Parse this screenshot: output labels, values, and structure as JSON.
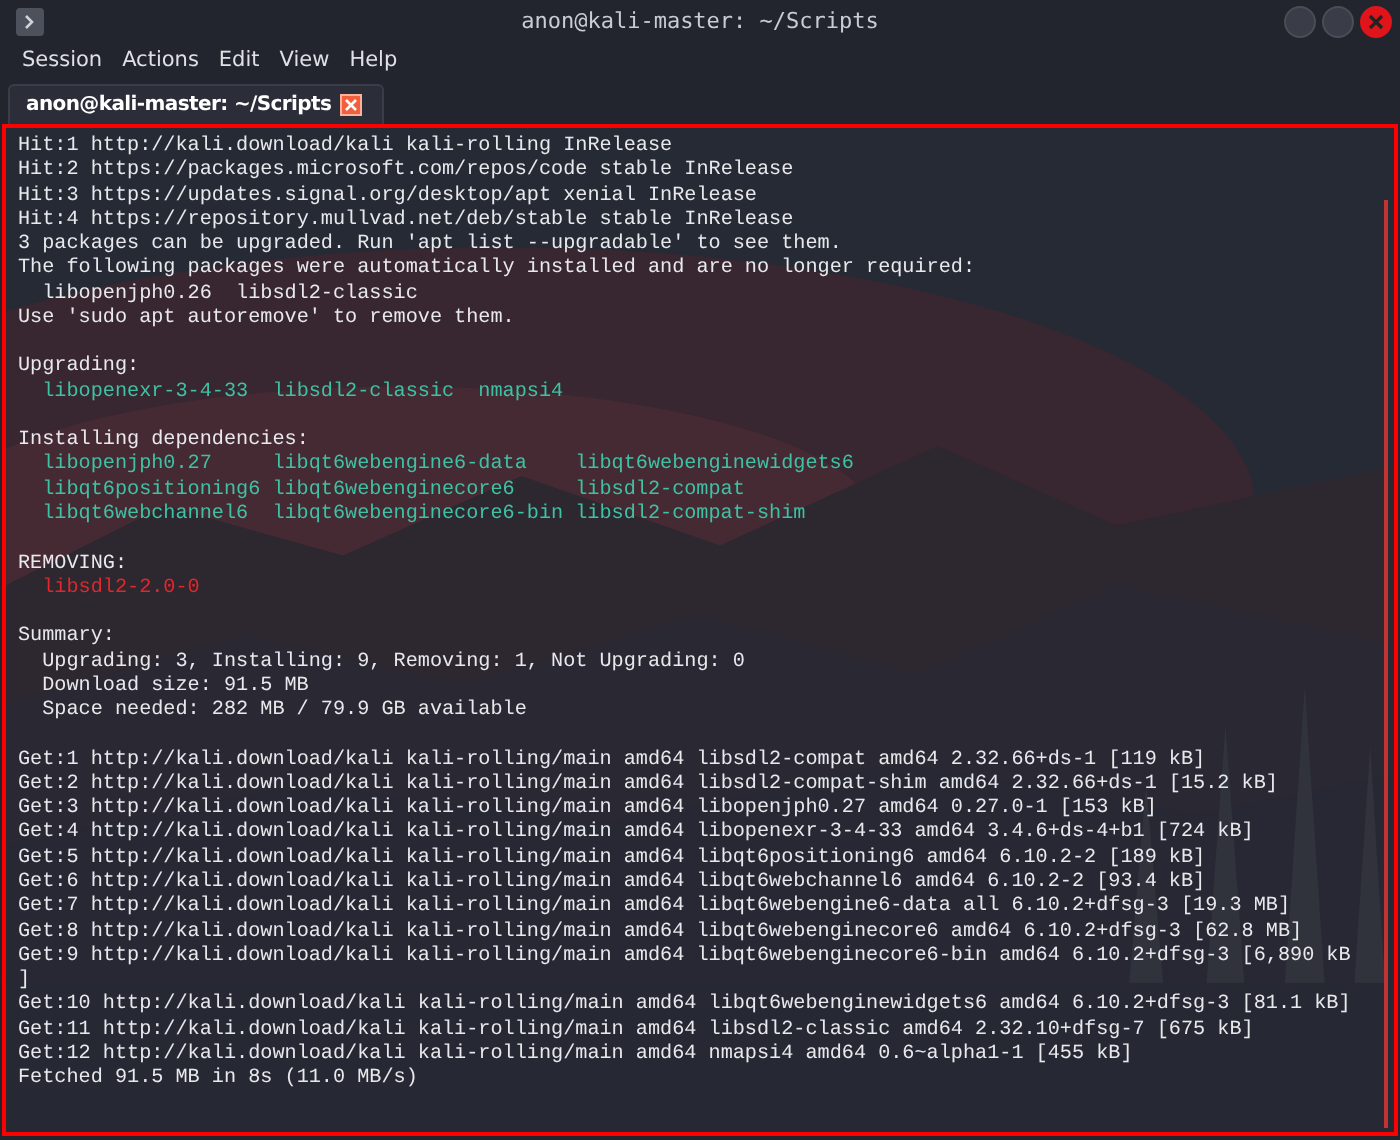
{
  "window": {
    "title": "anon@kali-master: ~/Scripts"
  },
  "menu": [
    "Session",
    "Actions",
    "Edit",
    "View",
    "Help"
  ],
  "tabs": [
    {
      "label": "anon@kali-master: ~/Scripts",
      "selected": true
    }
  ],
  "terminal": {
    "lines": [
      {
        "kind": "text",
        "text": "Hit:1 http://kali.download/kali kali-rolling InRelease"
      },
      {
        "kind": "text",
        "text": "Hit:2 https://packages.microsoft.com/repos/code stable InRelease"
      },
      {
        "kind": "text",
        "text": "Hit:3 https://updates.signal.org/desktop/apt xenial InRelease"
      },
      {
        "kind": "text",
        "text": "Hit:4 https://repository.mullvad.net/deb/stable stable InRelease"
      },
      {
        "kind": "text",
        "text": "3 packages can be upgraded. Run 'apt list --upgradable' to see them."
      },
      {
        "kind": "text",
        "text": "The following packages were automatically installed and are no longer required:"
      },
      {
        "kind": "indented",
        "text": "libopenjph0.26  libsdl2-classic"
      },
      {
        "kind": "text",
        "text": "Use 'sudo apt autoremove' to remove them."
      },
      {
        "kind": "blank"
      },
      {
        "kind": "text",
        "text": "Upgrading:"
      },
      {
        "kind": "packages",
        "items": [
          "libopenexr-3-4-33",
          "libsdl2-classic",
          "nmapsi4"
        ]
      },
      {
        "kind": "blank"
      },
      {
        "kind": "text",
        "text": "Installing dependencies:"
      },
      {
        "kind": "package-table",
        "rows": [
          [
            "libopenjph0.27",
            "libqt6webengine6-data",
            "libqt6webenginewidgets6"
          ],
          [
            "libqt6positioning6",
            "libqt6webenginecore6",
            "libsdl2-compat"
          ],
          [
            "libqt6webchannel6",
            "libqt6webenginecore6-bin",
            "libsdl2-compat-shim"
          ]
        ]
      },
      {
        "kind": "blank"
      },
      {
        "kind": "text",
        "text": "REMOVING:"
      },
      {
        "kind": "removed",
        "items": [
          "libsdl2-2.0-0"
        ]
      },
      {
        "kind": "blank"
      },
      {
        "kind": "text",
        "text": "Summary:"
      },
      {
        "kind": "indented",
        "text": "Upgrading: 3, Installing: 9, Removing: 1, Not Upgrading: 0"
      },
      {
        "kind": "indented",
        "text": "Download size: 91.5 MB"
      },
      {
        "kind": "indented",
        "text": "Space needed: 282 MB / 79.9 GB available"
      },
      {
        "kind": "blank"
      },
      {
        "kind": "text",
        "text": "Get:1 http://kali.download/kali kali-rolling/main amd64 libsdl2-compat amd64 2.32.66+ds-1 [119 kB]"
      },
      {
        "kind": "text",
        "text": "Get:2 http://kali.download/kali kali-rolling/main amd64 libsdl2-compat-shim amd64 2.32.66+ds-1 [15.2 kB]"
      },
      {
        "kind": "text",
        "text": "Get:3 http://kali.download/kali kali-rolling/main amd64 libopenjph0.27 amd64 0.27.0-1 [153 kB]"
      },
      {
        "kind": "text",
        "text": "Get:4 http://kali.download/kali kali-rolling/main amd64 libopenexr-3-4-33 amd64 3.4.6+ds-4+b1 [724 kB]"
      },
      {
        "kind": "text",
        "text": "Get:5 http://kali.download/kali kali-rolling/main amd64 libqt6positioning6 amd64 6.10.2-2 [189 kB]"
      },
      {
        "kind": "text",
        "text": "Get:6 http://kali.download/kali kali-rolling/main amd64 libqt6webchannel6 amd64 6.10.2-2 [93.4 kB]"
      },
      {
        "kind": "text",
        "text": "Get:7 http://kali.download/kali kali-rolling/main amd64 libqt6webengine6-data all 6.10.2+dfsg-3 [19.3 MB]"
      },
      {
        "kind": "text",
        "text": "Get:8 http://kali.download/kali kali-rolling/main amd64 libqt6webenginecore6 amd64 6.10.2+dfsg-3 [62.8 MB]"
      },
      {
        "kind": "text",
        "text": "Get:9 http://kali.download/kali kali-rolling/main amd64 libqt6webenginecore6-bin amd64 6.10.2+dfsg-3 [6,890 kB"
      },
      {
        "kind": "text",
        "text": "]"
      },
      {
        "kind": "text",
        "text": "Get:10 http://kali.download/kali kali-rolling/main amd64 libqt6webenginewidgets6 amd64 6.10.2+dfsg-3 [81.1 kB]"
      },
      {
        "kind": "text",
        "text": "Get:11 http://kali.download/kali kali-rolling/main amd64 libsdl2-classic amd64 2.32.10+dfsg-7 [675 kB]"
      },
      {
        "kind": "text",
        "text": "Get:12 http://kali.download/kali kali-rolling/main amd64 nmapsi4 amd64 0.6~alpha1-1 [455 kB]"
      },
      {
        "kind": "text",
        "text": "Fetched 91.5 MB in 8s (11.0 MB/s)"
      }
    ]
  }
}
